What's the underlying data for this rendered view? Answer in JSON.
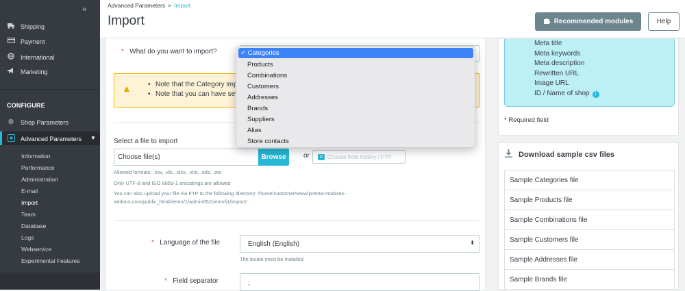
{
  "sidebar": {
    "collapse_icon": "double-chevron-left-icon",
    "items": [
      {
        "label": "Shipping",
        "icon": "truck-icon"
      },
      {
        "label": "Payment",
        "icon": "credit-card-icon"
      },
      {
        "label": "International",
        "icon": "globe-icon"
      },
      {
        "label": "Marketing",
        "icon": "megaphone-icon"
      }
    ],
    "section_title": "CONFIGURE",
    "config_items": [
      {
        "label": "Shop Parameters",
        "icon": "gear-icon"
      },
      {
        "label": "Advanced Parameters",
        "icon": "settings-box-icon"
      }
    ],
    "sub_items": [
      "Information",
      "Performance",
      "Administration",
      "E-mail",
      "Import",
      "Team",
      "Database",
      "Logs",
      "Webservice",
      "Experimental Features"
    ],
    "current_sub_item": "Import"
  },
  "header": {
    "breadcrumb_parent": "Advanced Parameters",
    "breadcrumb_separator": ">",
    "breadcrumb_current": "Import",
    "title": "Import",
    "recommended_label": "Recommended modules",
    "help_label": "Help"
  },
  "form": {
    "import_label": "What do you want to import?",
    "required_mark": "*",
    "warning_line1": "Note that the Category imp",
    "warning_line2": "Note that you can have sev",
    "file_label": "Select a file to import",
    "file_placeholder": "Choose file(s)",
    "browse_label": "Browse",
    "or_label": "or",
    "history_count": "0",
    "history_label": "Choose from history / FTP",
    "help_formats": "Allowed formats: .csv, .xls, .xlsx, .xlst, .ods, .ots",
    "help_encoding": "Only UTF-8 and ISO 8859-1 encodings are allowed",
    "help_ftp_line1": "You can also upload your file via FTP to the following directory: /home/customer/www/presta-modules-",
    "help_ftp_line2": "addons.com/public_html/demo/1/admin652oemvfi1/import/ .",
    "language_label": "Language of the file",
    "language_value": "English (English)",
    "language_help": "The locale must be installed",
    "separator_label": "Field separator",
    "separator_value": ";"
  },
  "dropdown": {
    "selected": "Categories",
    "check": "✓",
    "options": [
      "Products",
      "Combinations",
      "Customers",
      "Addresses",
      "Brands",
      "Suppliers",
      "Alias",
      "Store contacts"
    ]
  },
  "fields_list": {
    "items": [
      "Meta title",
      "Meta keywords",
      "Meta description",
      "Rewritten URL",
      "Image URL",
      "ID / Name of shop"
    ],
    "required_note": "* Required field"
  },
  "downloads": {
    "title": "Download sample csv files",
    "items": [
      "Sample Categories file",
      "Sample Products file",
      "Sample Combinations file",
      "Sample Customers file",
      "Sample Addresses file",
      "Sample Brands file"
    ]
  },
  "colors": {
    "accent": "#25b9d7",
    "sidebar_bg": "#363a41",
    "warning_bg": "#fff3d7",
    "required": "#c05c67",
    "dropdown_selected": "#3b83f7"
  }
}
